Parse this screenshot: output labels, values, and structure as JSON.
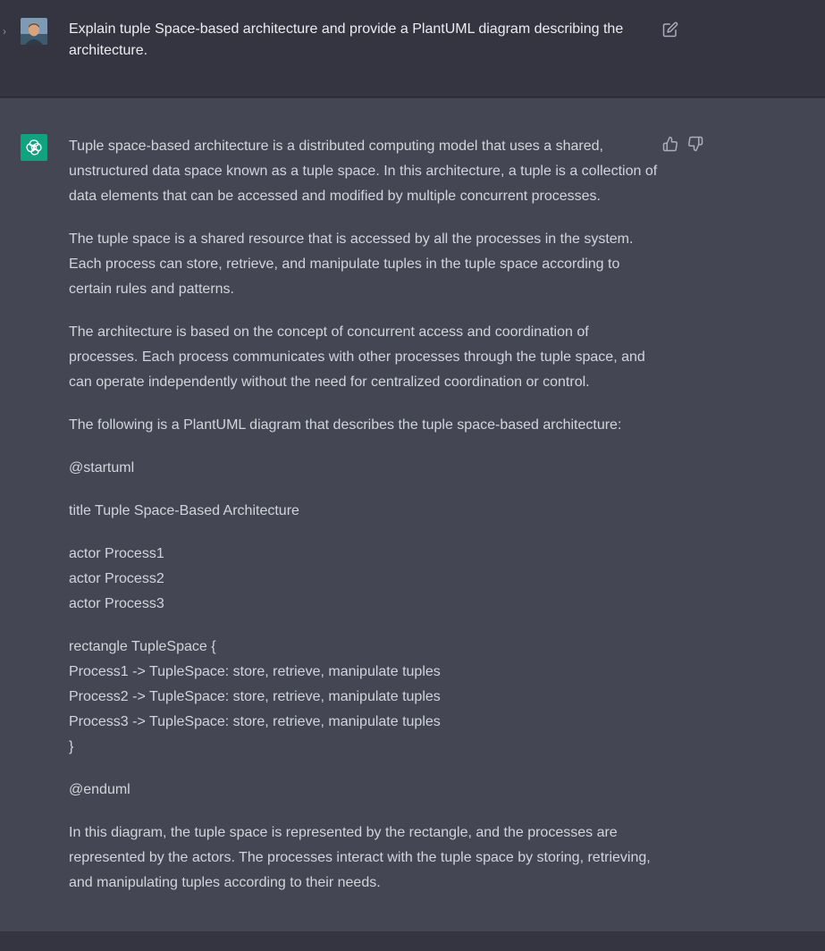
{
  "user_message": {
    "text": "Explain tuple Space-based architecture and provide a PlantUML diagram describing the architecture.",
    "avatar_icon": "user-avatar-photo",
    "edit_icon": "edit-icon"
  },
  "assistant_message": {
    "avatar_icon": "openai-logo-icon",
    "avatar_color": "#10a37f",
    "paragraphs": [
      "Tuple space-based architecture is a distributed computing model that uses a shared, unstructured data space known as a tuple space. In this architecture, a tuple is a collection of data elements that can be accessed and modified by multiple concurrent processes.",
      "The tuple space is a shared resource that is accessed by all the processes in the system. Each process can store, retrieve, and manipulate tuples in the tuple space according to certain rules and patterns.",
      "The architecture is based on the concept of concurrent access and coordination of processes. Each process communicates with other processes through the tuple space, and can operate independently without the need for centralized coordination or control.",
      "The following is a PlantUML diagram that describes the tuple space-based architecture:"
    ],
    "startuml": "@startuml",
    "title_line": "title Tuple Space-Based Architecture",
    "actors": [
      "actor Process1",
      "actor Process2",
      "actor Process3"
    ],
    "rectangle_open": "rectangle TupleSpace {",
    "rectangle_lines": [
      "Process1 -> TupleSpace: store, retrieve, manipulate tuples",
      "Process2 -> TupleSpace: store, retrieve, manipulate tuples",
      "Process3 -> TupleSpace: store, retrieve, manipulate tuples"
    ],
    "rectangle_close": "}",
    "enduml": "@enduml",
    "closing": "In this diagram, the tuple space is represented by the rectangle, and the processes are represented by the actors. The processes interact with the tuple space by storing, retrieving, and manipulating tuples according to their needs."
  },
  "feedback": {
    "thumbs_up_icon": "thumbs-up-icon",
    "thumbs_down_icon": "thumbs-down-icon"
  },
  "colors": {
    "user_bg": "#343541",
    "assistant_bg": "#444654",
    "text": "#d1d5db"
  }
}
